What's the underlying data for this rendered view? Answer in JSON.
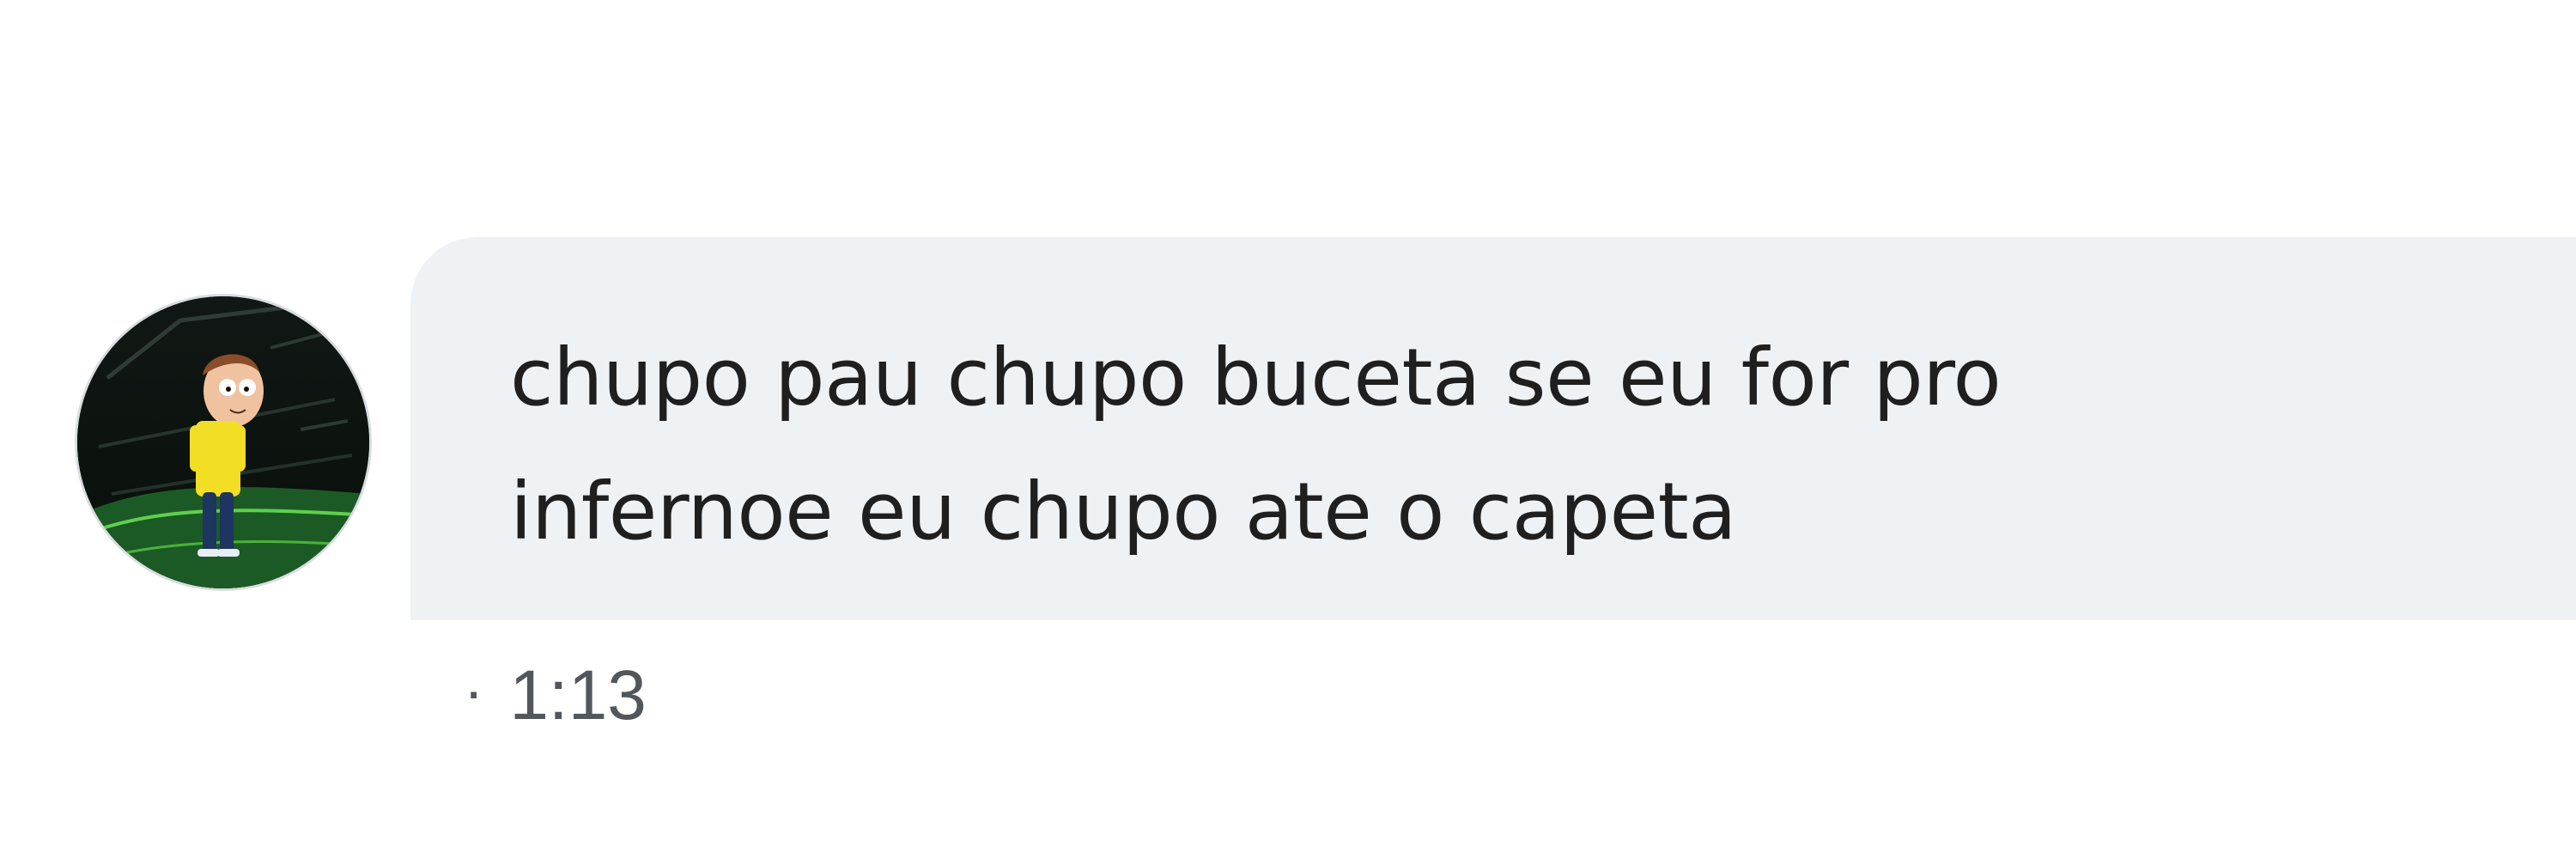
{
  "message": {
    "text": "chupo pau chupo buceta se eu for pro\ninfernoe eu chupo ate o capeta",
    "timestamp_separator": "·",
    "timestamp": "1:13"
  },
  "avatar": {
    "icon": "character-avatar-icon"
  },
  "colors": {
    "bubble_bg": "#eff2f5",
    "text": "#1f1f1f",
    "timestamp": "#52575c"
  }
}
